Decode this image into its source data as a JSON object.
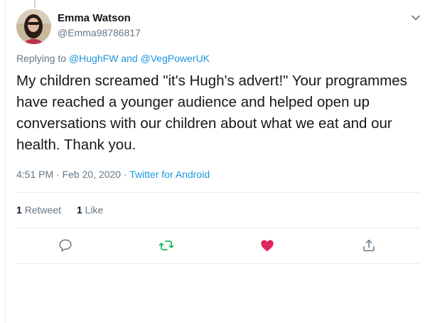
{
  "author": {
    "name": "Emma Watson",
    "handle": "@Emma98786817"
  },
  "reply": {
    "prefix": "Replying to ",
    "user1": "@HughFW",
    "conj": " and ",
    "user2": "@VegPowerUK"
  },
  "tweet": {
    "text": "My children screamed \"it's Hugh's advert!\" Your programmes have reached a younger audience and helped open up conversations with our children about what we eat and our health. Thank you.",
    "time": "4:51 PM · Feb 20, 2020 · ",
    "source": "Twitter for Android"
  },
  "stats": {
    "retweets_count": "1",
    "retweets_label": "Retweet",
    "likes_count": "1",
    "likes_label": "Like"
  },
  "icons": {
    "caret": "chevron-down-icon",
    "reply": "reply-icon",
    "retweet": "retweet-icon",
    "like": "heart-icon",
    "share": "share-icon"
  },
  "colors": {
    "link": "#1b95e0",
    "retweet": "#17bf63",
    "like": "#e0245e",
    "muted": "#657786"
  }
}
